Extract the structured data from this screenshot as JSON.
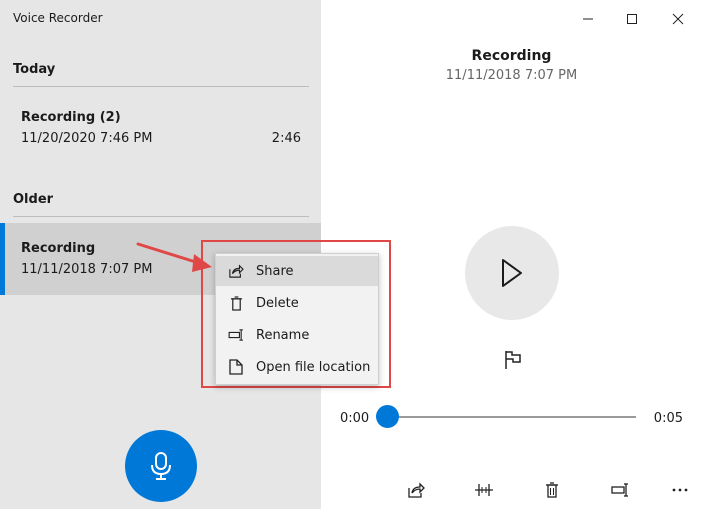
{
  "window": {
    "title": "Voice Recorder"
  },
  "sections": [
    {
      "header": "Today"
    },
    {
      "header": "Older"
    }
  ],
  "recordings": [
    {
      "name": "Recording (2)",
      "date": "11/20/2020 7:46 PM",
      "duration": "2:46"
    },
    {
      "name": "Recording",
      "date": "11/11/2018 7:07 PM",
      "duration": ""
    }
  ],
  "player": {
    "title": "Recording",
    "date": "11/11/2018 7:07 PM",
    "time_start": "0:00",
    "time_end": "0:05",
    "progress": 0
  },
  "context_menu": {
    "items": [
      {
        "label": "Share",
        "icon": "share-icon"
      },
      {
        "label": "Delete",
        "icon": "trash-icon"
      },
      {
        "label": "Rename",
        "icon": "rename-icon"
      },
      {
        "label": "Open file location",
        "icon": "file-location-icon"
      }
    ],
    "hovered_index": 0
  },
  "toolbar": {
    "icons": [
      "share-icon",
      "trim-icon",
      "trash-icon",
      "rename-icon",
      "more-icon"
    ]
  },
  "colors": {
    "accent": "#0078d7",
    "annotation": "#e04848",
    "left_pane": "#e6e6e6"
  }
}
